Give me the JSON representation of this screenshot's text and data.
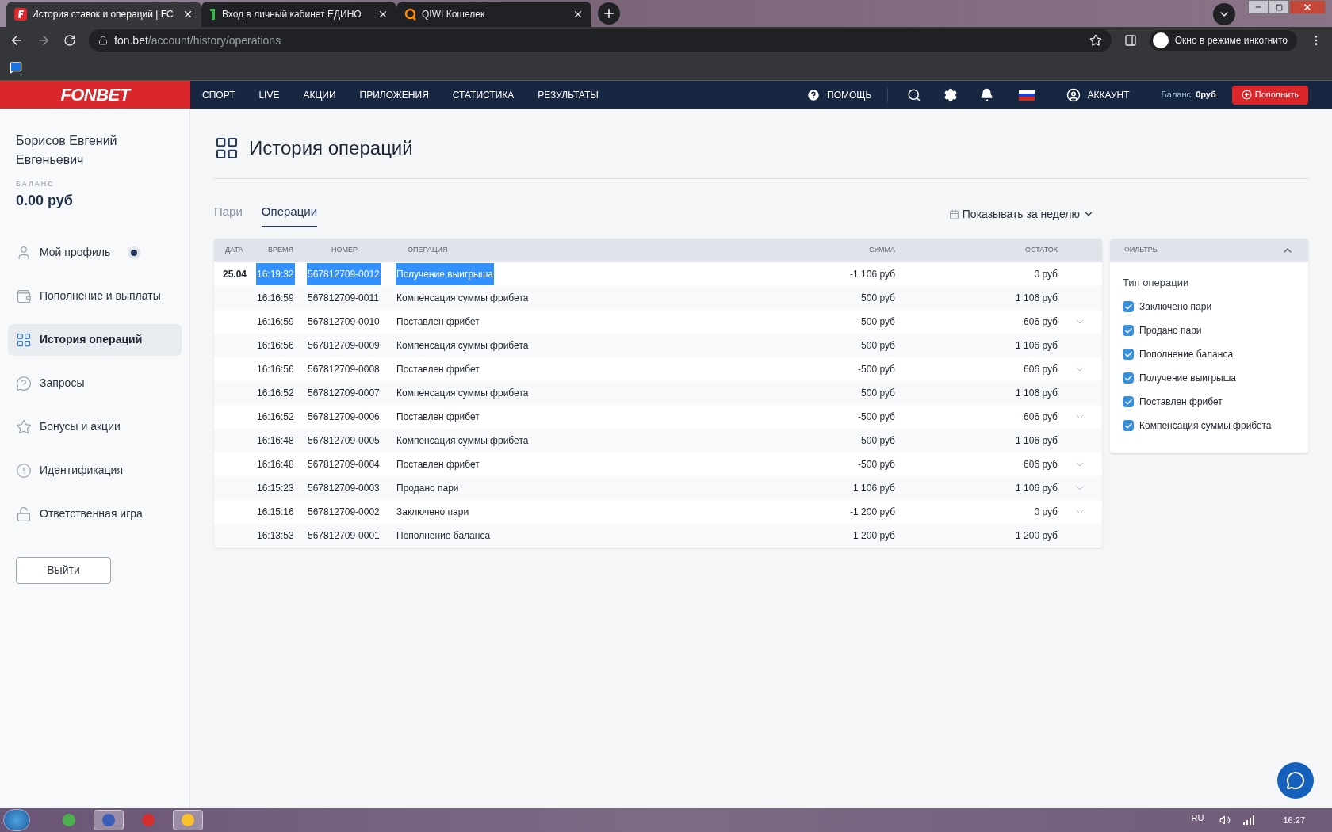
{
  "browser": {
    "tabs": [
      {
        "title": "История ставок и операций | FC",
        "selected": true,
        "kind": "fonbet"
      },
      {
        "title": "Вход в личный кабинет ЕДИНО",
        "selected": false,
        "kind": "edin"
      },
      {
        "title": "QIWI Кошелек",
        "selected": false,
        "kind": "qiwi"
      }
    ],
    "url_host": "fon.bet",
    "url_path": "/account/history/operations",
    "incognito_label": "Окно в режиме инкогнито"
  },
  "header": {
    "logo": "FONBET",
    "nav": [
      "СПОРТ",
      "LIVE",
      "АКЦИИ",
      "ПРИЛОЖЕНИЯ",
      "СТАТИСТИКА",
      "РЕЗУЛЬТАТЫ"
    ],
    "help": "ПОМОЩЬ",
    "account": "АККАУНТ",
    "balance_label": "Баланс:",
    "balance_value": "0руб",
    "deposit_button": "Пополнить"
  },
  "sidebar": {
    "user_name": "Борисов Евгений Евгеньевич",
    "balance_label": "БАЛАНС",
    "balance": "0.00 руб",
    "items": [
      {
        "label": "Мой профиль",
        "kind": "user",
        "selected": false,
        "dot": true
      },
      {
        "label": "Пополнение и выплаты",
        "kind": "wallet",
        "selected": false,
        "dot": false
      },
      {
        "label": "История операций",
        "kind": "grid",
        "selected": true,
        "dot": false
      },
      {
        "label": "Запросы",
        "kind": "question",
        "selected": false,
        "dot": false
      },
      {
        "label": "Бонусы и акции",
        "kind": "star",
        "selected": false,
        "dot": false
      },
      {
        "label": "Идентификация",
        "kind": "alert",
        "selected": false,
        "dot": false
      },
      {
        "label": "Ответственная игра",
        "kind": "lock",
        "selected": false,
        "dot": false
      }
    ],
    "logout": "Выйти"
  },
  "page": {
    "title": "История операций",
    "tabs": [
      {
        "label": "Пари",
        "selected": false
      },
      {
        "label": "Операции",
        "selected": true
      }
    ],
    "period": "Показывать за неделю"
  },
  "table": {
    "columns": [
      "ДАТА",
      "ВРЕМЯ",
      "НОМЕР",
      "ОПЕРАЦИЯ",
      "СУММА",
      "ОСТАТОК"
    ],
    "rows": [
      {
        "date": "25.04",
        "time": "16:19:32",
        "number": "567812709-0012",
        "operation": "Получение выигрыша",
        "amount": "-1 106 руб",
        "rest": "0 руб",
        "text_selected": true,
        "expandable": false
      },
      {
        "time": "16:16:59",
        "number": "567812709-0011",
        "operation": "Компенсация суммы фрибета",
        "amount": "500 руб",
        "rest": "1 106 руб",
        "text_selected": false,
        "expandable": false
      },
      {
        "time": "16:16:59",
        "number": "567812709-0010",
        "operation": "Поставлен фрибет",
        "amount": "-500 руб",
        "rest": "606 руб",
        "text_selected": false,
        "expandable": true
      },
      {
        "time": "16:16:56",
        "number": "567812709-0009",
        "operation": "Компенсация суммы фрибета",
        "amount": "500 руб",
        "rest": "1 106 руб",
        "text_selected": false,
        "expandable": false
      },
      {
        "time": "16:16:56",
        "number": "567812709-0008",
        "operation": "Поставлен фрибет",
        "amount": "-500 руб",
        "rest": "606 руб",
        "text_selected": false,
        "expandable": true
      },
      {
        "time": "16:16:52",
        "number": "567812709-0007",
        "operation": "Компенсация суммы фрибета",
        "amount": "500 руб",
        "rest": "1 106 руб",
        "text_selected": false,
        "expandable": false
      },
      {
        "time": "16:16:52",
        "number": "567812709-0006",
        "operation": "Поставлен фрибет",
        "amount": "-500 руб",
        "rest": "606 руб",
        "text_selected": false,
        "expandable": true
      },
      {
        "time": "16:16:48",
        "number": "567812709-0005",
        "operation": "Компенсация суммы фрибета",
        "amount": "500 руб",
        "rest": "1 106 руб",
        "text_selected": false,
        "expandable": false
      },
      {
        "time": "16:16:48",
        "number": "567812709-0004",
        "operation": "Поставлен фрибет",
        "amount": "-500 руб",
        "rest": "606 руб",
        "text_selected": false,
        "expandable": true
      },
      {
        "time": "16:15:23",
        "number": "567812709-0003",
        "operation": "Продано пари",
        "amount": "1 106 руб",
        "rest": "1 106 руб",
        "text_selected": false,
        "expandable": true
      },
      {
        "time": "16:15:16",
        "number": "567812709-0002",
        "operation": "Заключено пари",
        "amount": "-1 200 руб",
        "rest": "0 руб",
        "text_selected": false,
        "expandable": true
      },
      {
        "time": "16:13:53",
        "number": "567812709-0001",
        "operation": "Пополнение баланса",
        "amount": "1 200 руб",
        "rest": "1 200 руб",
        "text_selected": false,
        "expandable": false
      }
    ]
  },
  "filters": {
    "title": "ФИЛЬТРЫ",
    "expanded": true,
    "group_label": "Тип операции",
    "options": [
      {
        "label": "Заключено пари",
        "checked": true
      },
      {
        "label": "Продано пари",
        "checked": true
      },
      {
        "label": "Пополнение баланса",
        "checked": true
      },
      {
        "label": "Получение выигрыша",
        "checked": true
      },
      {
        "label": "Поставлен фрибет",
        "checked": true
      },
      {
        "label": "Компенсация суммы фрибета",
        "checked": true
      }
    ]
  },
  "taskbar": {
    "language": "RU",
    "time": "16:27"
  }
}
